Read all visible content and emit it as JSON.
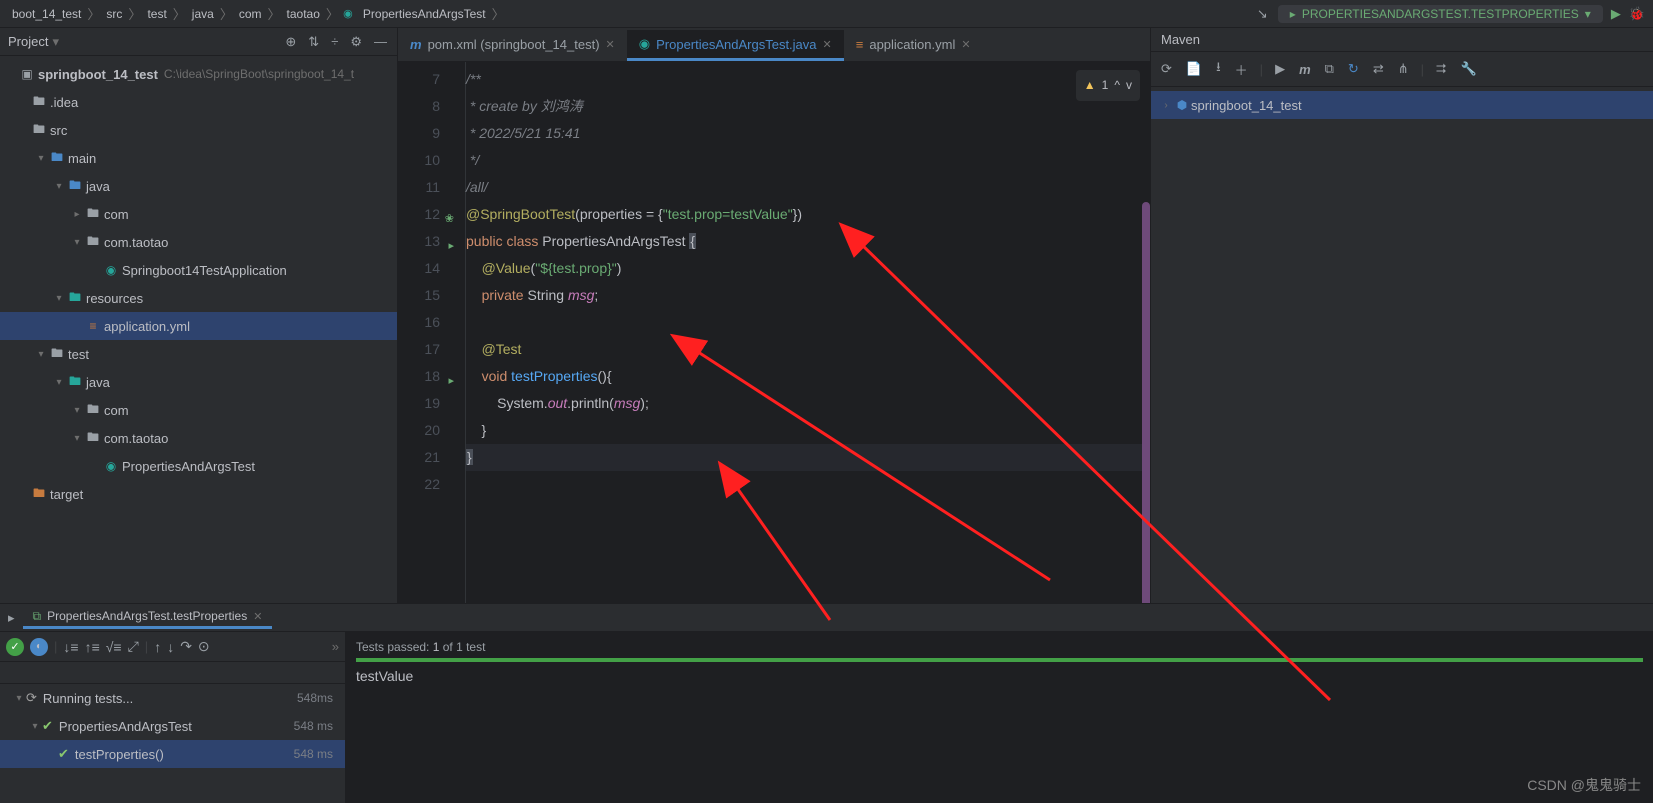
{
  "breadcrumb": {
    "items": [
      "boot_14_test",
      "src",
      "test",
      "java",
      "com",
      "taotao",
      "PropertiesAndArgsTest"
    ],
    "last_icon_name": "class-icon"
  },
  "run_config": {
    "label": "PROPERTIESANDARGSTEST.TESTPROPERTIES"
  },
  "project": {
    "header": "Project",
    "root": {
      "label": "springboot_14_test",
      "path": "C:\\idea\\SpringBoot\\springboot_14_t"
    },
    "tree": [
      {
        "indent": 0,
        "chevron": "",
        "icon": "folder",
        "label": ".idea"
      },
      {
        "indent": 0,
        "chevron": "",
        "icon": "folder",
        "label": "src"
      },
      {
        "indent": 1,
        "chevron": "v",
        "icon": "folder-blue",
        "label": "main"
      },
      {
        "indent": 2,
        "chevron": "v",
        "icon": "folder-blue",
        "label": "java"
      },
      {
        "indent": 3,
        "chevron": ">",
        "icon": "folder",
        "label": "com"
      },
      {
        "indent": 3,
        "chevron": "v",
        "icon": "folder",
        "label": "com.taotao"
      },
      {
        "indent": 4,
        "chevron": "",
        "icon": "class",
        "label": "Springboot14TestApplication"
      },
      {
        "indent": 2,
        "chevron": "v",
        "icon": "folder-teal",
        "label": "resources"
      },
      {
        "indent": 3,
        "chevron": "",
        "icon": "yml",
        "label": "application.yml",
        "selected": true
      },
      {
        "indent": 1,
        "chevron": "v",
        "icon": "folder",
        "label": "test"
      },
      {
        "indent": 2,
        "chevron": "v",
        "icon": "folder-teal",
        "label": "java"
      },
      {
        "indent": 3,
        "chevron": "v",
        "icon": "folder",
        "label": "com"
      },
      {
        "indent": 3,
        "chevron": "v",
        "icon": "folder",
        "label": "com.taotao"
      },
      {
        "indent": 4,
        "chevron": "",
        "icon": "class",
        "label": "PropertiesAndArgsTest"
      },
      {
        "indent": 0,
        "chevron": "",
        "icon": "folder-orange",
        "label": "target"
      }
    ]
  },
  "tabs": [
    {
      "icon": "m",
      "label": "pom.xml (springboot_14_test)",
      "active": false
    },
    {
      "icon": "c",
      "label": "PropertiesAndArgsTest.java",
      "active": true
    },
    {
      "icon": "y",
      "label": "application.yml",
      "active": false
    }
  ],
  "editor": {
    "inspections": {
      "warn_count": "1"
    },
    "lines": [
      {
        "n": 7,
        "html": "<span class='c-comment'>/**</span>"
      },
      {
        "n": 8,
        "html": "<span class='c-comment'> * create by 刘鸿涛</span>"
      },
      {
        "n": 9,
        "html": "<span class='c-comment'> * 2022/5/21 15:41</span>"
      },
      {
        "n": 10,
        "html": "<span class='c-comment'> */</span>"
      },
      {
        "n": 11,
        "html": "<span class='c-comment'>/all/</span>"
      },
      {
        "n": 12,
        "html": "<span class='c-anno'>@SpringBootTest</span><span class='c-paren'>(</span><span class='c-named'>properties</span> = {<span class='c-string'>\"test.prop=testValue\"</span>})",
        "gicon": "leaf"
      },
      {
        "n": 13,
        "html": "<span class='c-keyword'>public</span> <span class='c-keyword'>class</span> <span class='c-class'>PropertiesAndArgsTest</span> <span class='c-cursor'>{</span>",
        "gicon": "run"
      },
      {
        "n": 14,
        "html": "    <span class='c-anno'>@Value</span>(<span class='c-string'>\"${test.prop}\"</span>)"
      },
      {
        "n": 15,
        "html": "    <span class='c-keyword'>private</span> <span class='c-class'>String</span> <span class='c-field'>msg</span>;"
      },
      {
        "n": 16,
        "html": ""
      },
      {
        "n": 17,
        "html": "    <span class='c-anno'>@Test</span>"
      },
      {
        "n": 18,
        "html": "    <span class='c-keyword'>void</span> <span class='c-method'>testProperties</span>(){",
        "gicon": "run"
      },
      {
        "n": 19,
        "html": "        System.<span class='c-field'>out</span>.println(<span class='c-field'>msg</span>);"
      },
      {
        "n": 20,
        "html": "    }"
      },
      {
        "n": 21,
        "html": "<span class='c-cursor'>}</span>",
        "current": true
      },
      {
        "n": 22,
        "html": ""
      }
    ]
  },
  "maven": {
    "title": "Maven",
    "tree": [
      {
        "label": "springboot_14_test"
      }
    ]
  },
  "bottom": {
    "tab_label": "PropertiesAndArgsTest.testProperties",
    "status": {
      "prefix": "Tests passed:",
      "count": "1",
      "suffix": "of 1 test"
    },
    "tree": [
      {
        "indent": 0,
        "icon": "spinner",
        "label": "Running tests...",
        "time": "548ms"
      },
      {
        "indent": 1,
        "icon": "pass",
        "label": "PropertiesAndArgsTest",
        "time": "548 ms"
      },
      {
        "indent": 2,
        "icon": "pass",
        "label": "testProperties()",
        "time": "548 ms",
        "selected": true
      }
    ],
    "output": "testValue"
  },
  "watermark": "CSDN @鬼鬼骑士"
}
